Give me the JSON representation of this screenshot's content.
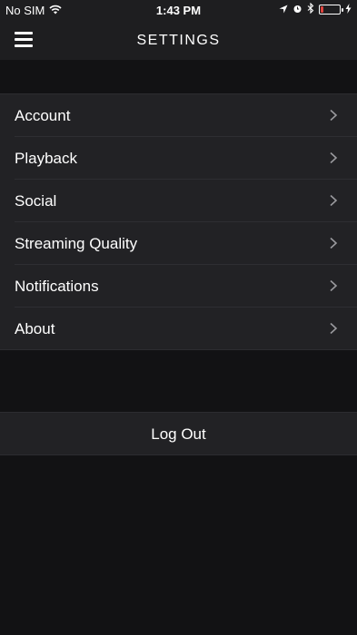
{
  "status_bar": {
    "carrier": "No SIM",
    "time": "1:43 PM",
    "battery_level": 0.15,
    "battery_color": "#e0443e",
    "icons": [
      "wifi-icon",
      "location-icon",
      "alarm-icon",
      "bluetooth-icon",
      "battery-icon",
      "charging-icon"
    ]
  },
  "nav": {
    "title": "SETTINGS",
    "menu_icon": "hamburger-menu-icon"
  },
  "settings": {
    "items": [
      {
        "label": "Account"
      },
      {
        "label": "Playback"
      },
      {
        "label": "Social"
      },
      {
        "label": "Streaming Quality"
      },
      {
        "label": "Notifications"
      },
      {
        "label": "About"
      }
    ],
    "chevron_icon": "chevron-right-icon"
  },
  "logout": {
    "label": "Log Out"
  },
  "colors": {
    "background": "#121214",
    "bar": "#1e1e20",
    "row": "#222225",
    "text": "#ffffff",
    "chevron": "#9a9a9e"
  }
}
